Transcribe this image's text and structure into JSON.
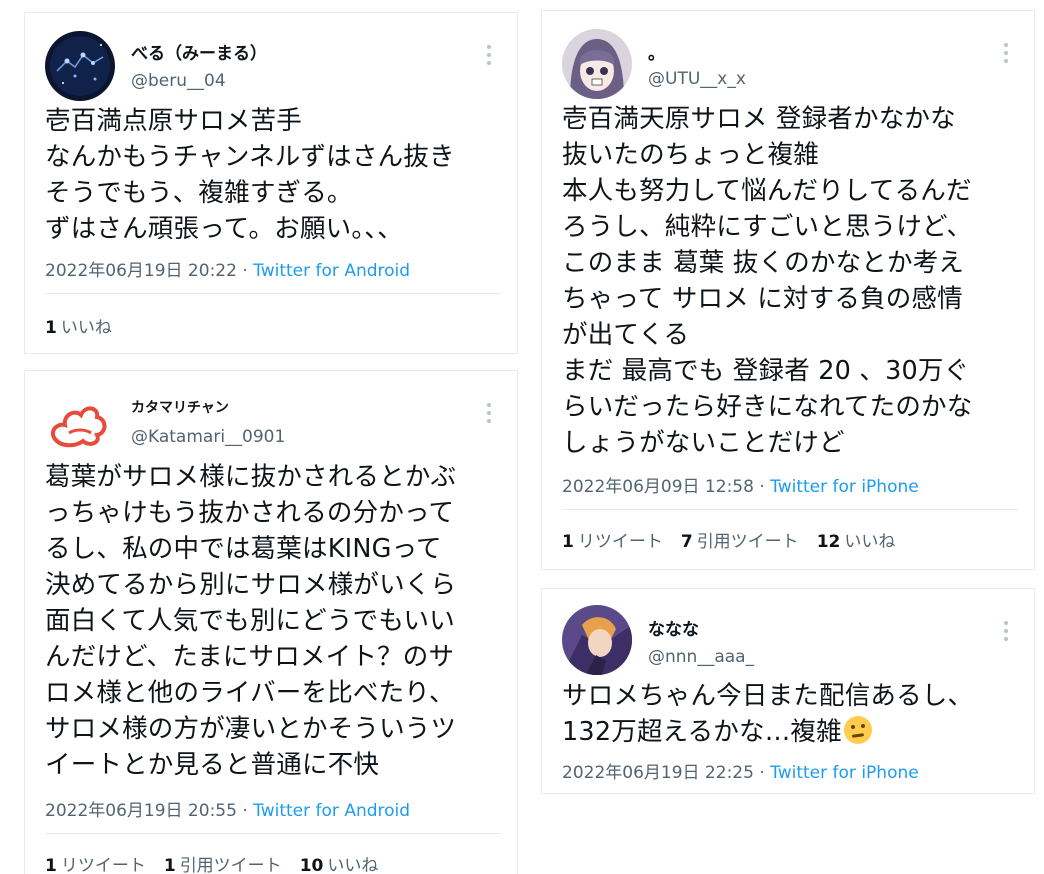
{
  "tweets": [
    {
      "display_name": "べる（みーまる）",
      "handle": "@beru__04",
      "text": "壱百満点原サロメ苦手\nなんかもうチャンネルずはさん抜き\nそうでもう、複雑すぎる。\nずはさん頑張って。お願い。、、",
      "timestamp": "2022年06月19日 20:22",
      "source": "Twitter for Android",
      "stats": [
        {
          "count": "1",
          "label": "いいね"
        }
      ]
    },
    {
      "display_name": "カタマリチャン",
      "handle": "@Katamari__0901",
      "text": "葛葉がサロメ様に抜かされるとかぶ\nっちゃけもう抜かされるの分かって\nるし、私の中では葛葉はKINGって\n決めてるから別にサロメ様がいくら\n面白くて人気でも別にどうでもいい\nんだけど、たまにサロメイト？のサ\nロメ様と他のライバーを比べたり、\nサロメ様の方が凄いとかそういうツ\nイートとか見ると普通に不快",
      "timestamp": "2022年06月19日 20:55",
      "source": "Twitter for Android",
      "stats": [
        {
          "count": "1",
          "label": "リツイート"
        },
        {
          "count": "1",
          "label": "引用ツイート"
        },
        {
          "count": "10",
          "label": "いいね"
        }
      ]
    },
    {
      "display_name": "。",
      "handle": "@UTU__x_x",
      "text": "壱百満天原サロメ 登録者かなかな\n抜いたのちょっと複雑\n本人も努力して悩んだりしてるんだ\nろうし、純粋にすごいと思うけど、\nこのまま 葛葉 抜くのかなとか考え\nちゃって サロメ に対する負の感情\nが出てくる\nまだ 最高でも 登録者 20 、30万ぐ\nらいだったら好きになれてたのかな\nしょうがないことだけど",
      "timestamp": "2022年06月09日 12:58",
      "source": "Twitter for iPhone",
      "stats": [
        {
          "count": "1",
          "label": "リツイート"
        },
        {
          "count": "7",
          "label": "引用ツイート"
        },
        {
          "count": "12",
          "label": "いいね"
        }
      ]
    },
    {
      "display_name": "ななな",
      "handle": "@nnn__aaa_",
      "text": "サロメちゃん今日また配信あるし、\n132万超えるかな…複雑",
      "emoji": "face-with-raised-eyebrow-emoji",
      "timestamp": "2022年06月19日 22:25",
      "source": "Twitter for iPhone",
      "stats": []
    }
  ],
  "separator": " · ",
  "colors": {
    "link": "#1d9bf0",
    "muted": "#536471",
    "text": "#0f1419",
    "border": "#e6ecf0"
  }
}
